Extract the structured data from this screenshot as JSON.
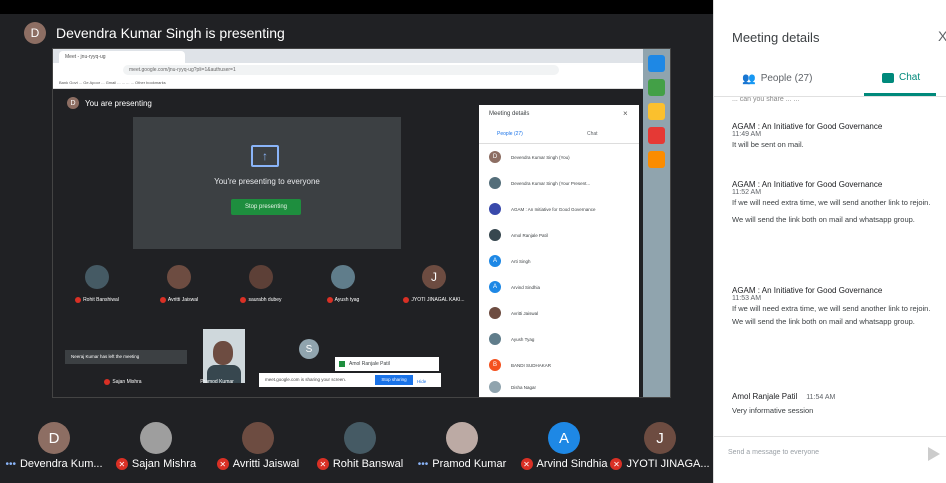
{
  "presenter": {
    "initial": "D",
    "text": "Devendra Kumar Singh is presenting"
  },
  "shared_screen": {
    "tab_label": "Meet - jnu-ryyq-ug",
    "url": "meet.google.com/jnu-ryyq-ug?pli=1&authuser=1",
    "bookmarks": "Bank   Govt ...   Ge Apoor   ...   Gmail   ...   ...   ...   ...   Other bookmarks",
    "you_presenting_initial": "D",
    "you_presenting": "You are presenting",
    "present_icon": "present-screen-icon",
    "presenting_to_everyone": "You're presenting to everyone",
    "stop_presenting": "Stop presenting",
    "tiles": [
      {
        "name": "Rohit Banshiwal",
        "initial": "",
        "color": "#455a64"
      },
      {
        "name": "Avritti Jaiswal",
        "initial": "",
        "color": "#6d4c41"
      },
      {
        "name": "saurabh dubey",
        "initial": "",
        "color": "#5d4037"
      },
      {
        "name": "Ayush tyag",
        "initial": "",
        "color": "#607d8b"
      },
      {
        "name": "JYOTI JINAGAL KAKI...",
        "initial": "J",
        "color": "#6d4c41"
      }
    ],
    "left_toast": "Neeraj Kumar has left the meeting",
    "row2_names": [
      "Sajan Mishra",
      "Pramod Kumar"
    ],
    "row2_initial": "S",
    "small_bar_text": "meet.google.com is sharing your screen.",
    "small_bar_stop": "Stop sharing",
    "small_bar_hide": "Hide",
    "pip_name": "Amol Ranjale Patil",
    "inner_panel": {
      "title": "Meeting details",
      "people_tab": "People (27)",
      "chat_tab": "Chat",
      "rows": [
        {
          "initial": "D",
          "name": "Devendra Kumar Singh (You)",
          "color": "#8d6e63"
        },
        {
          "initial": "",
          "name": "Devendra Kumar Singh (Your Present...",
          "color": "#546e7a"
        },
        {
          "initial": "",
          "name": "AGAM : An Initiative for Good Governance",
          "color": "#3949ab"
        },
        {
          "initial": "",
          "name": "Amol Ranjale Patil",
          "color": "#37474f"
        },
        {
          "initial": "A",
          "name": "Arti Singh",
          "color": "#1e88e5"
        },
        {
          "initial": "A",
          "name": "Arvind Sindhia",
          "color": "#1e88e5"
        },
        {
          "initial": "",
          "name": "Avritti Jaiswal",
          "color": "#6d4c41"
        },
        {
          "initial": "",
          "name": "Ayush Tyag",
          "color": "#607d8b"
        },
        {
          "initial": "B",
          "name": "BANDI SUDHAKAR",
          "color": "#f4511e"
        },
        {
          "initial": "",
          "name": "Disha Nagar",
          "color": "#90a4ae"
        }
      ]
    }
  },
  "filmstrip": [
    {
      "initial": "D",
      "name": "Devendra Kum...",
      "color": "#8d6e63",
      "status": "dots"
    },
    {
      "initial": "",
      "name": "Sajan Mishra",
      "color": "#9e9e9e",
      "status": "mic"
    },
    {
      "initial": "",
      "name": "Avritti Jaiswal",
      "color": "#6d4c41",
      "status": "mic"
    },
    {
      "initial": "",
      "name": "Rohit Banswal",
      "color": "#455a64",
      "status": "mic"
    },
    {
      "initial": "",
      "name": "Pramod Kumar",
      "color": "#bcaaa4",
      "status": "dots"
    },
    {
      "initial": "A",
      "name": "Arvind Sindhia",
      "color": "#1e88e5",
      "status": "mic"
    },
    {
      "initial": "J",
      "name": "JYOTI JINAGA...",
      "color": "#6d4c41",
      "status": "mic"
    }
  ],
  "panel": {
    "title": "Meeting details",
    "close": "X",
    "people_tab": "People (27)",
    "chat_tab": "Chat",
    "cut_text": "... can you share ... ...",
    "messages": [
      {
        "sender": "AGAM : An Initiative for Good Governance",
        "time": "11:49 AM",
        "lines": [
          "It will be sent on mail."
        ]
      },
      {
        "sender": "AGAM : An Initiative for Good Governance",
        "time": "11:52 AM",
        "lines": [
          "If we will need extra time, we will send another link to rejoin.",
          "We will send the link both on mail and whatsapp group."
        ]
      },
      {
        "sender": "AGAM : An Initiative for Good Governance",
        "time": "11:53 AM",
        "lines": [
          "If we will need extra time, we will send another link to rejoin.",
          "We will send the link both on mail and whatsapp group."
        ]
      },
      {
        "sender": "Amol Ranjale Patil",
        "time": "11:54 AM",
        "lines": [
          "Very informative session"
        ]
      }
    ],
    "compose_placeholder": "Send a message to everyone"
  }
}
